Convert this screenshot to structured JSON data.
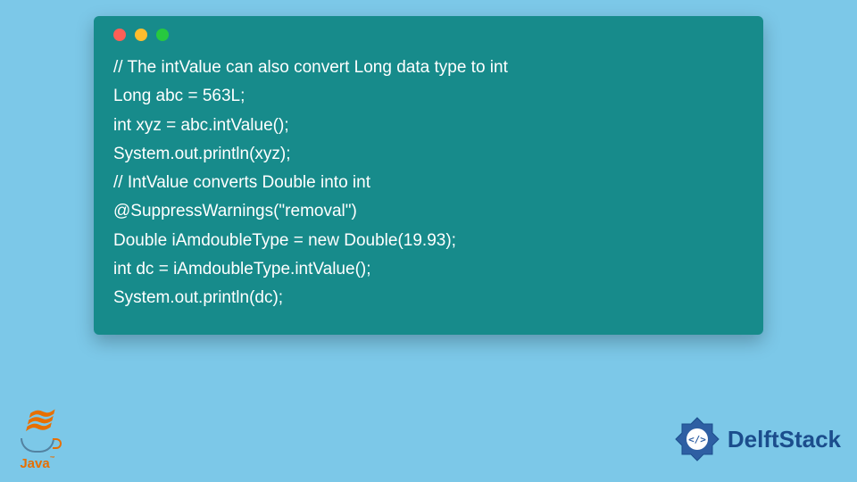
{
  "code": {
    "lines": [
      "// The intValue can also convert Long data type to int",
      "Long abc = 563L;",
      "int xyz = abc.intValue();",
      "System.out.println(xyz);",
      "// IntValue converts Double into int",
      "@SuppressWarnings(\"removal\")",
      "Double iAmdoubleType = new Double(19.93);",
      "int dc = iAmdoubleType.intValue();",
      "System.out.println(dc);"
    ]
  },
  "logos": {
    "java_label": "Java",
    "delft_label": "DelftStack"
  }
}
